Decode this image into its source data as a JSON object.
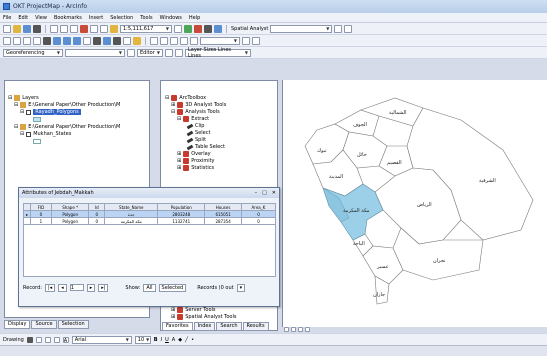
{
  "window": {
    "title": "OKT ProjectMap - ArcInfo"
  },
  "menu": [
    "File",
    "Edit",
    "View",
    "Bookmarks",
    "Insert",
    "Selection",
    "Tools",
    "Windows",
    "Help"
  ],
  "toolbar": {
    "scale_value": "1:5,111,617",
    "spatial_analyst_label": "Spatial Analyst",
    "georeferencing_label": "Georeferencing",
    "editor_label": "Editor",
    "layer_combo": "Layer Sizes Lines Lines"
  },
  "toc": {
    "layers_label": "Layers",
    "item1": "E:\\General Paper\\Other Production\\M",
    "item1_child": "Rayadh_Polygons",
    "item2": "E:\\General Paper\\Other Production\\M",
    "item2_child": "Mukhan_States",
    "tabs": [
      "Display",
      "Source",
      "Selection"
    ]
  },
  "toolbox": {
    "title": "ArcToolbox",
    "items": [
      "3D Analyst Tools",
      "Analysis Tools",
      "Extract",
      "Clip",
      "Select",
      "Split",
      "Table Select",
      "Overlay",
      "Proximity",
      "Statistics",
      "Server Tools",
      "Spatial Analyst Tools"
    ],
    "tabs": [
      "Favorites",
      "Index",
      "Search",
      "Results"
    ]
  },
  "attributes": {
    "title": "Attributes of Jebdah_Makkah",
    "columns": [
      "FID",
      "Shape *",
      "Id",
      "State_Name",
      "Population",
      "Houses",
      "Area_K"
    ],
    "rows": [
      [
        "0",
        "Polygon",
        "0",
        "جدة",
        "2803248",
        "615051",
        "0"
      ],
      [
        "1",
        "Polygon",
        "0",
        "مكة المكرمة",
        "1132741",
        "287354",
        "0"
      ]
    ],
    "record_label": "Record:",
    "record_value": "1",
    "show_label": "Show:",
    "all_label": "All",
    "selected_label": "Selected",
    "records_label": "Records (0 out",
    "options_label": "Options"
  },
  "map": {
    "labels": {
      "tabuk": "تبوك",
      "jawf": "الجوف",
      "hail": "حائل",
      "qassim": "القصيم",
      "madinah": "المدينة",
      "riyadh": "الرياض",
      "sharqiyah": "الشرقية",
      "makkah": "مكة المكرمة",
      "baha": "الباحة",
      "asir": "عسير",
      "jizan": "جازان",
      "najran": "نجران",
      "shamal": "الشمالية"
    },
    "highlight_color": "#9cd0e8"
  },
  "drawbar": {
    "drawing_label": "Drawing",
    "font_value": "Arial",
    "font_size": "10"
  },
  "status": {
    "left": "",
    "right": ""
  }
}
